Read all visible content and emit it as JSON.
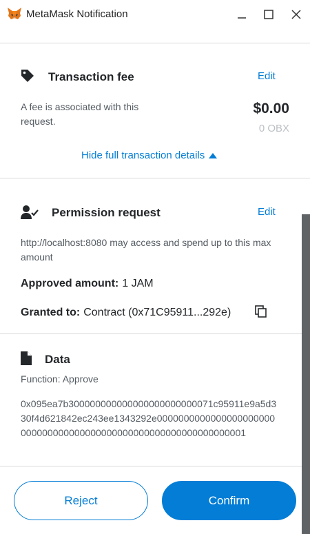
{
  "window": {
    "title": "MetaMask Notification"
  },
  "fee": {
    "title": "Transaction fee",
    "edit_label": "Edit",
    "description": "A fee is associated with this request.",
    "amount_usd": "$0.00",
    "amount_token": "0 OBX",
    "hide_details_label": "Hide full transaction details"
  },
  "permission": {
    "title": "Permission request",
    "edit_label": "Edit",
    "description": "http://localhost:8080 may access and spend up to this max amount",
    "approved_label": "Approved amount:",
    "approved_value": "1 JAM",
    "granted_label": "Granted to:",
    "granted_value": "Contract (0x71C95911...292e)"
  },
  "data": {
    "title": "Data",
    "function_label": "Function: Approve",
    "hex": "0x095ea7b300000000000000000000000071c95911e9a5d330f4d621842ec243ee1343292e0000000000000000000000000000000000000000000000000000000000000001"
  },
  "actions": {
    "reject_label": "Reject",
    "confirm_label": "Confirm"
  },
  "colors": {
    "accent": "#037dd6",
    "text": "#24272a",
    "muted": "#535a61",
    "divider": "#d6d9dc"
  },
  "icons": {
    "fox": "metamask-fox-icon",
    "fee": "price-tag-icon",
    "permission": "user-check-icon",
    "data": "document-icon",
    "copy": "copy-icon",
    "caret": "caret-up-icon"
  }
}
